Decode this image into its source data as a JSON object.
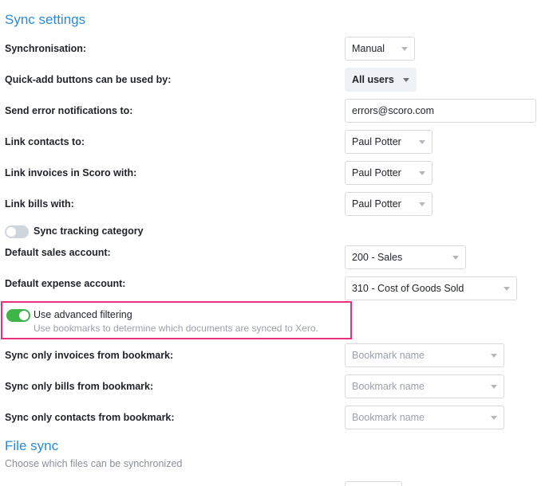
{
  "sync_settings": {
    "title": "Sync settings",
    "synchronisation": {
      "label": "Synchronisation:",
      "value": "Manual"
    },
    "quick_add": {
      "label": "Quick-add buttons can be used by:",
      "value": "All users"
    },
    "error_notifications": {
      "label": "Send error notifications to:",
      "value": "errors@scoro.com"
    },
    "link_contacts": {
      "label": "Link contacts to:",
      "value": "Paul Potter"
    },
    "link_invoices": {
      "label": "Link invoices in Scoro with:",
      "value": "Paul Potter"
    },
    "link_bills": {
      "label": "Link bills with:",
      "value": "Paul Potter"
    },
    "sync_tracking": {
      "label": "Sync tracking category",
      "enabled": false
    },
    "default_sales": {
      "label": "Default sales account:",
      "value": "200 - Sales"
    },
    "default_expense": {
      "label": "Default expense account:",
      "value": "310 - Cost of Goods Sold"
    },
    "advanced_filtering": {
      "label": "Use advanced filtering",
      "description": "Use bookmarks to determine which documents are synced to Xero.",
      "enabled": true,
      "highlight_color": "#e8317a"
    },
    "invoices_bookmark": {
      "label": "Sync only invoices from bookmark:",
      "placeholder": "Bookmark name"
    },
    "bills_bookmark": {
      "label": "Sync only bills from bookmark:",
      "placeholder": "Bookmark name"
    },
    "contacts_bookmark": {
      "label": "Sync only contacts from bookmark:",
      "placeholder": "Bookmark name"
    }
  },
  "file_sync": {
    "title": "File sync",
    "subtitle": "Choose which files can be synchronized"
  },
  "colors": {
    "accent": "#2b8ad8",
    "toggle_on": "#3cb44a",
    "toggle_off": "#cfd5dd"
  }
}
